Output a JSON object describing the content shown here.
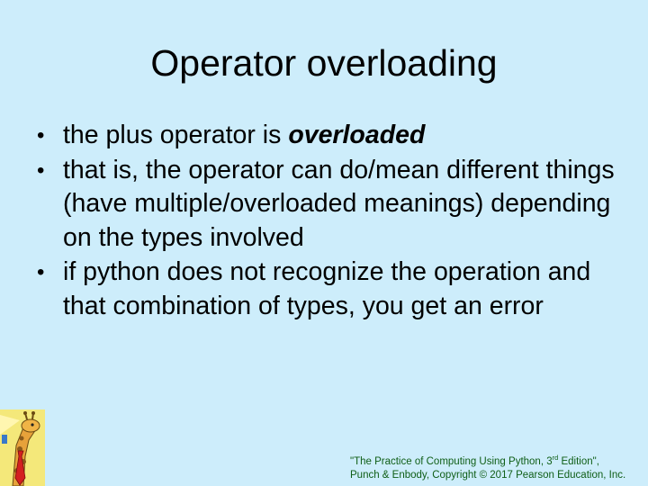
{
  "slide": {
    "title": "Operator overloading",
    "bullets": [
      {
        "prefix": "the plus operator is ",
        "emphasis": "overloaded",
        "suffix": ""
      },
      {
        "prefix": "that is, the operator can do/mean different things (have multiple/overloaded meanings) depending on the types involved",
        "emphasis": "",
        "suffix": ""
      },
      {
        "prefix": "if python does not recognize the operation and that combination of types, you get an error",
        "emphasis": "",
        "suffix": ""
      }
    ],
    "bullet_glyph": "•",
    "footer": {
      "line1_part1": "\"The Practice of Computing Using Python, 3",
      "line1_sup": "rd",
      "line1_part2": " Edition\",",
      "line2": "Punch & Enbody, Copyright © 2017 Pearson Education, Inc."
    },
    "logo_icon": "giraffe-icon",
    "colors": {
      "background": "#cdedfb",
      "footer_text": "#0f5e16"
    }
  }
}
